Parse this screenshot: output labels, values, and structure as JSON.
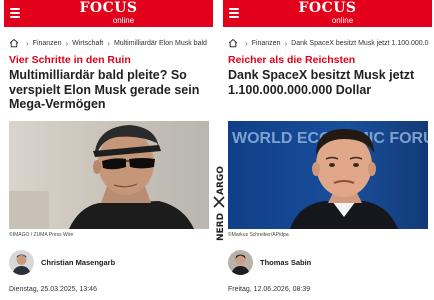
{
  "left": {
    "logo": {
      "main": "FOCUS",
      "sub": "online"
    },
    "breadcrumb": [
      "Finanzen",
      "Wirtschaft",
      "Multimilliardär Elon Musk bald"
    ],
    "kicker": "Vier Schritte in den Ruin",
    "headline": "Multimilliardär bald pleite? So verspielt Elon Musk gerade sein Mega-Vermögen",
    "photo_credit": "©IMAGO / ZUMA Press Wire",
    "author": "Christian Masengarb",
    "date": "Dienstag, 25.03.2025, 13:46"
  },
  "right": {
    "logo": {
      "main": "FOCUS",
      "sub": "online"
    },
    "breadcrumb": [
      "Finanzen",
      "Dank SpaceX besitzt Musk jetzt 1.100.000.0"
    ],
    "kicker": "Reicher als die Reichsten",
    "headline": "Dank SpaceX besitzt Musk jetzt 1.100.000.000.000 Dollar",
    "photo_credit": "©Markus Schreiber/AP/dpa",
    "photo_backdrop_text": "WORLD ECONOMIC FORUM",
    "author": "Thomas Sabin",
    "date": "Freitag, 12.06.2026, 08:39"
  },
  "watermark": {
    "top": "ARGO",
    "bottom": "NERD"
  },
  "colors": {
    "brand_red": "#e2001a",
    "kicker_red": "#e2001a",
    "text": "#1a1a1a"
  },
  "icons": {
    "menu": "hamburger-menu-icon",
    "home": "home-icon",
    "separator": "chevron-right-icon"
  }
}
